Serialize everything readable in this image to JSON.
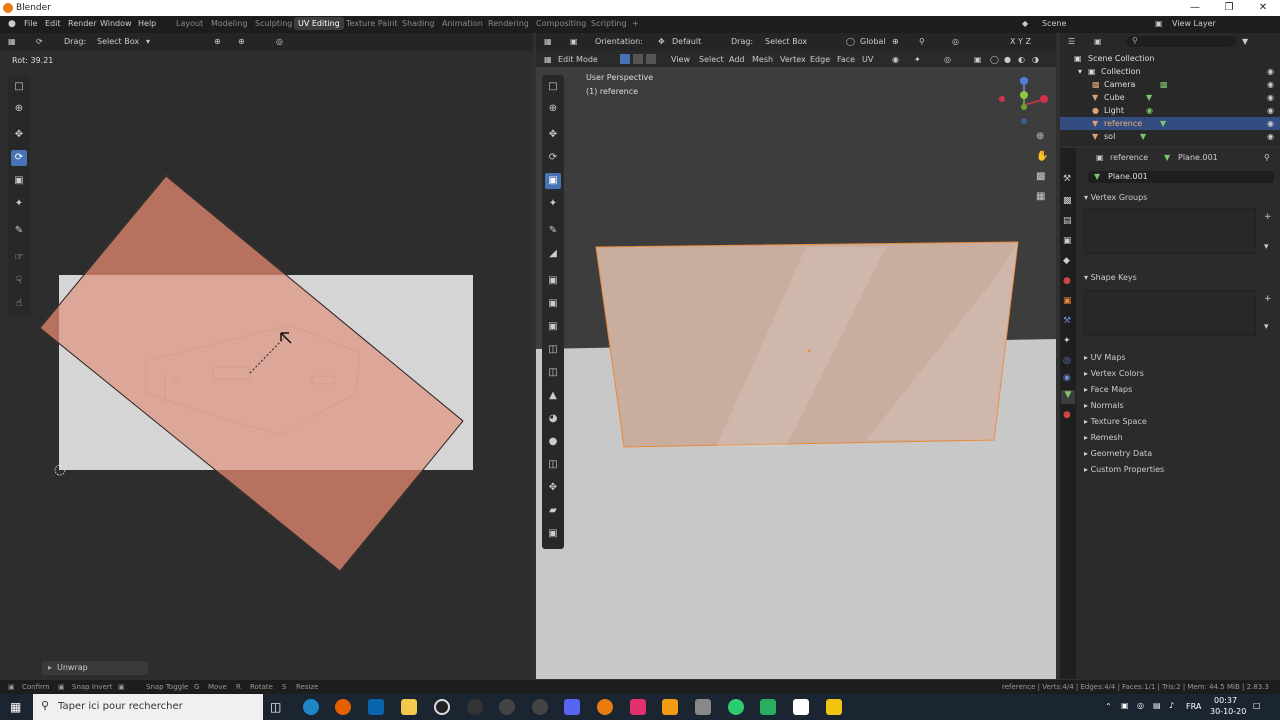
{
  "window": {
    "title": "Blender"
  },
  "menu": {
    "file": "File",
    "edit": "Edit",
    "render": "Render",
    "window": "Window",
    "help": "Help"
  },
  "workspaces": [
    "Layout",
    "Modeling",
    "Sculpting",
    "UV Editing",
    "Texture Paint",
    "Shading",
    "Animation",
    "Rendering",
    "Compositing",
    "Scripting"
  ],
  "workspace_add": "+",
  "scene": {
    "label": "Scene",
    "view_layer": "View Layer"
  },
  "uv_editor": {
    "drag_label": "Drag:",
    "drag_value": "Select Box",
    "rot_readout": "Rot: 39.21",
    "operator_panel": "Unwrap"
  },
  "viewport": {
    "orientation_label": "Orientation:",
    "orientation_value": "Default",
    "drag_label": "Drag:",
    "drag_value": "Select Box",
    "transform": "Global",
    "mode": "Edit Mode",
    "menus": [
      "View",
      "Select",
      "Add",
      "Mesh",
      "Vertex",
      "Edge",
      "Face",
      "UV"
    ],
    "perspective": "User Perspective",
    "object_info": "(1) reference",
    "axes": "X Y Z"
  },
  "outliner": {
    "root": "Scene Collection",
    "collection": "Collection",
    "items": [
      {
        "name": "Camera",
        "color": "#e0a070"
      },
      {
        "name": "Cube",
        "color": "#e0a070"
      },
      {
        "name": "Light",
        "color": "#e0a070"
      },
      {
        "name": "reference",
        "color": "#e0a070",
        "selected": true
      },
      {
        "name": "sol",
        "color": "#e0a070"
      }
    ]
  },
  "properties": {
    "object_name": "reference",
    "mesh_name": "Plane.001",
    "datablock": "Plane.001",
    "panels_top": [
      "Vertex Groups",
      "Shape Keys"
    ],
    "panels": [
      "UV Maps",
      "Vertex Colors",
      "Face Maps",
      "Normals",
      "Texture Space",
      "Remesh",
      "Geometry Data",
      "Custom Properties"
    ]
  },
  "status": {
    "confirm": "Confirm",
    "snap_invert": "Snap Invert",
    "snap_toggle": "Snap Toggle",
    "move_key": "G",
    "move": "Move",
    "rotate_key": "R",
    "rotate": "Rotate",
    "resize_key": "S",
    "resize": "Resize",
    "stats": "reference | Verts:4/4 | Edges:4/4 | Faces:1/1 | Tris:2 | Mem: 44.5 MiB | 2.83.3"
  },
  "taskbar": {
    "search_placeholder": "Taper ici pour rechercher",
    "lang": "FRA",
    "time": "00:37",
    "date": "30-10-20"
  },
  "colors": {
    "accent": "#4772b3",
    "mesh_face": "#d4806a",
    "selected_row": "#334d80"
  }
}
